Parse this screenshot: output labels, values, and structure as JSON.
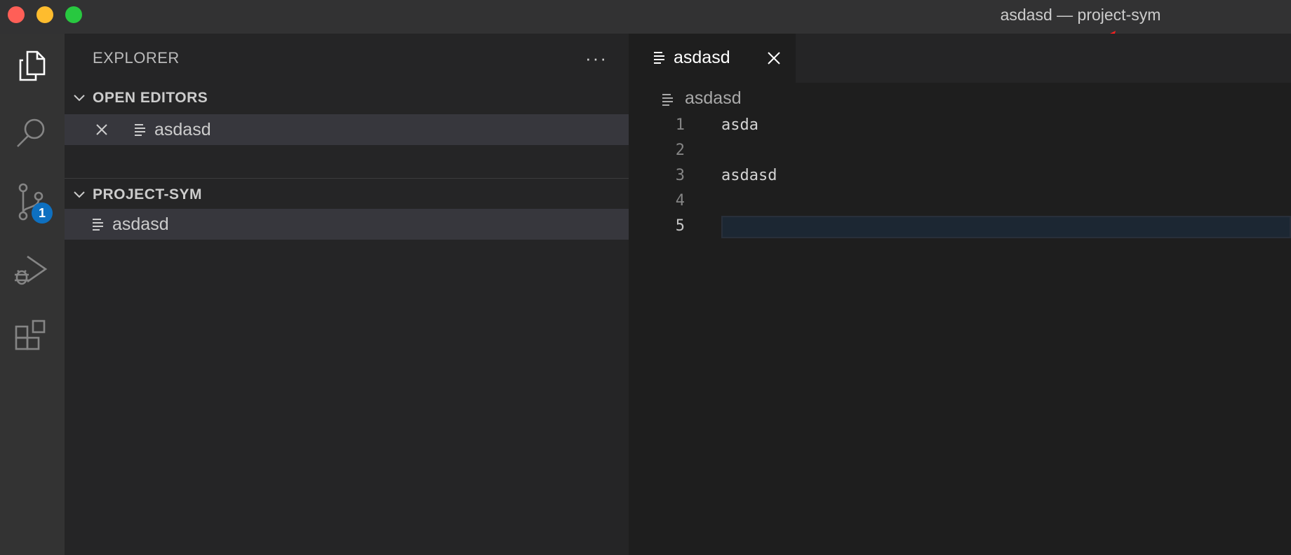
{
  "window": {
    "title": "asdasd — project-sym",
    "colors": {
      "close": "#ff5f57",
      "minimize": "#febc2e",
      "maximize": "#28c840",
      "annotation_arrow": "#ff2020"
    }
  },
  "activity_bar": {
    "items": [
      {
        "name": "explorer",
        "icon": "files-icon",
        "active": true
      },
      {
        "name": "search",
        "icon": "search-icon"
      },
      {
        "name": "source-control",
        "icon": "source-control-icon",
        "badge": "1"
      },
      {
        "name": "run-and-debug",
        "icon": "run-debug-icon"
      },
      {
        "name": "extensions",
        "icon": "extensions-icon"
      }
    ]
  },
  "sidebar": {
    "title": "EXPLORER",
    "more_label": "···",
    "open_editors": {
      "header": "OPEN EDITORS",
      "items": [
        {
          "label": "asdasd"
        }
      ]
    },
    "project": {
      "header": "PROJECT-SYM",
      "items": [
        {
          "label": "asdasd"
        }
      ]
    }
  },
  "editor": {
    "tabs": [
      {
        "label": "asdasd",
        "active": true
      }
    ],
    "breadcrumb": "asdasd",
    "lines": [
      {
        "number": "1",
        "text": "asda"
      },
      {
        "number": "2",
        "text": ""
      },
      {
        "number": "3",
        "text": "asdasd"
      },
      {
        "number": "4",
        "text": ""
      },
      {
        "number": "5",
        "text": ""
      }
    ],
    "current_line": 5
  }
}
